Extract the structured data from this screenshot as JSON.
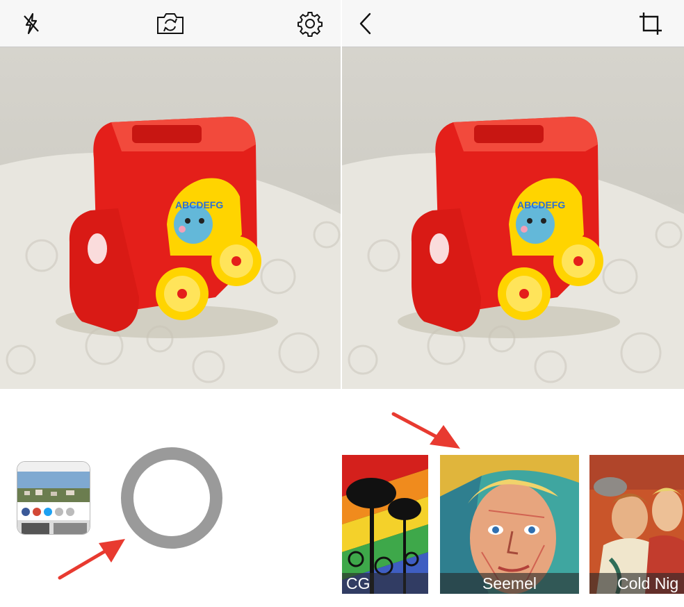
{
  "left_screen": {
    "toolbar": {
      "flash_icon": "flash-off-icon",
      "switch_camera_icon": "camera-switch-icon",
      "settings_icon": "gear-icon"
    },
    "photo": {
      "subject": "red toy train with yellow wheels"
    },
    "controls": {
      "gallery_icon": "gallery-thumbnail",
      "shutter_icon": "shutter-ring",
      "shutter_color": "#9a9a9a"
    }
  },
  "right_screen": {
    "toolbar": {
      "back_icon": "chevron-left-icon",
      "crop_icon": "crop-icon"
    },
    "filters": [
      {
        "label": "CG"
      },
      {
        "label": "Seemel"
      },
      {
        "label": "Cold Nig"
      }
    ]
  },
  "annotations": {
    "arrow_color": "#e83a30"
  },
  "colors": {
    "toolbar_bg": "#f7f7f7",
    "toy_red": "#e41f1a",
    "wheel_yellow": "#ffd400"
  }
}
